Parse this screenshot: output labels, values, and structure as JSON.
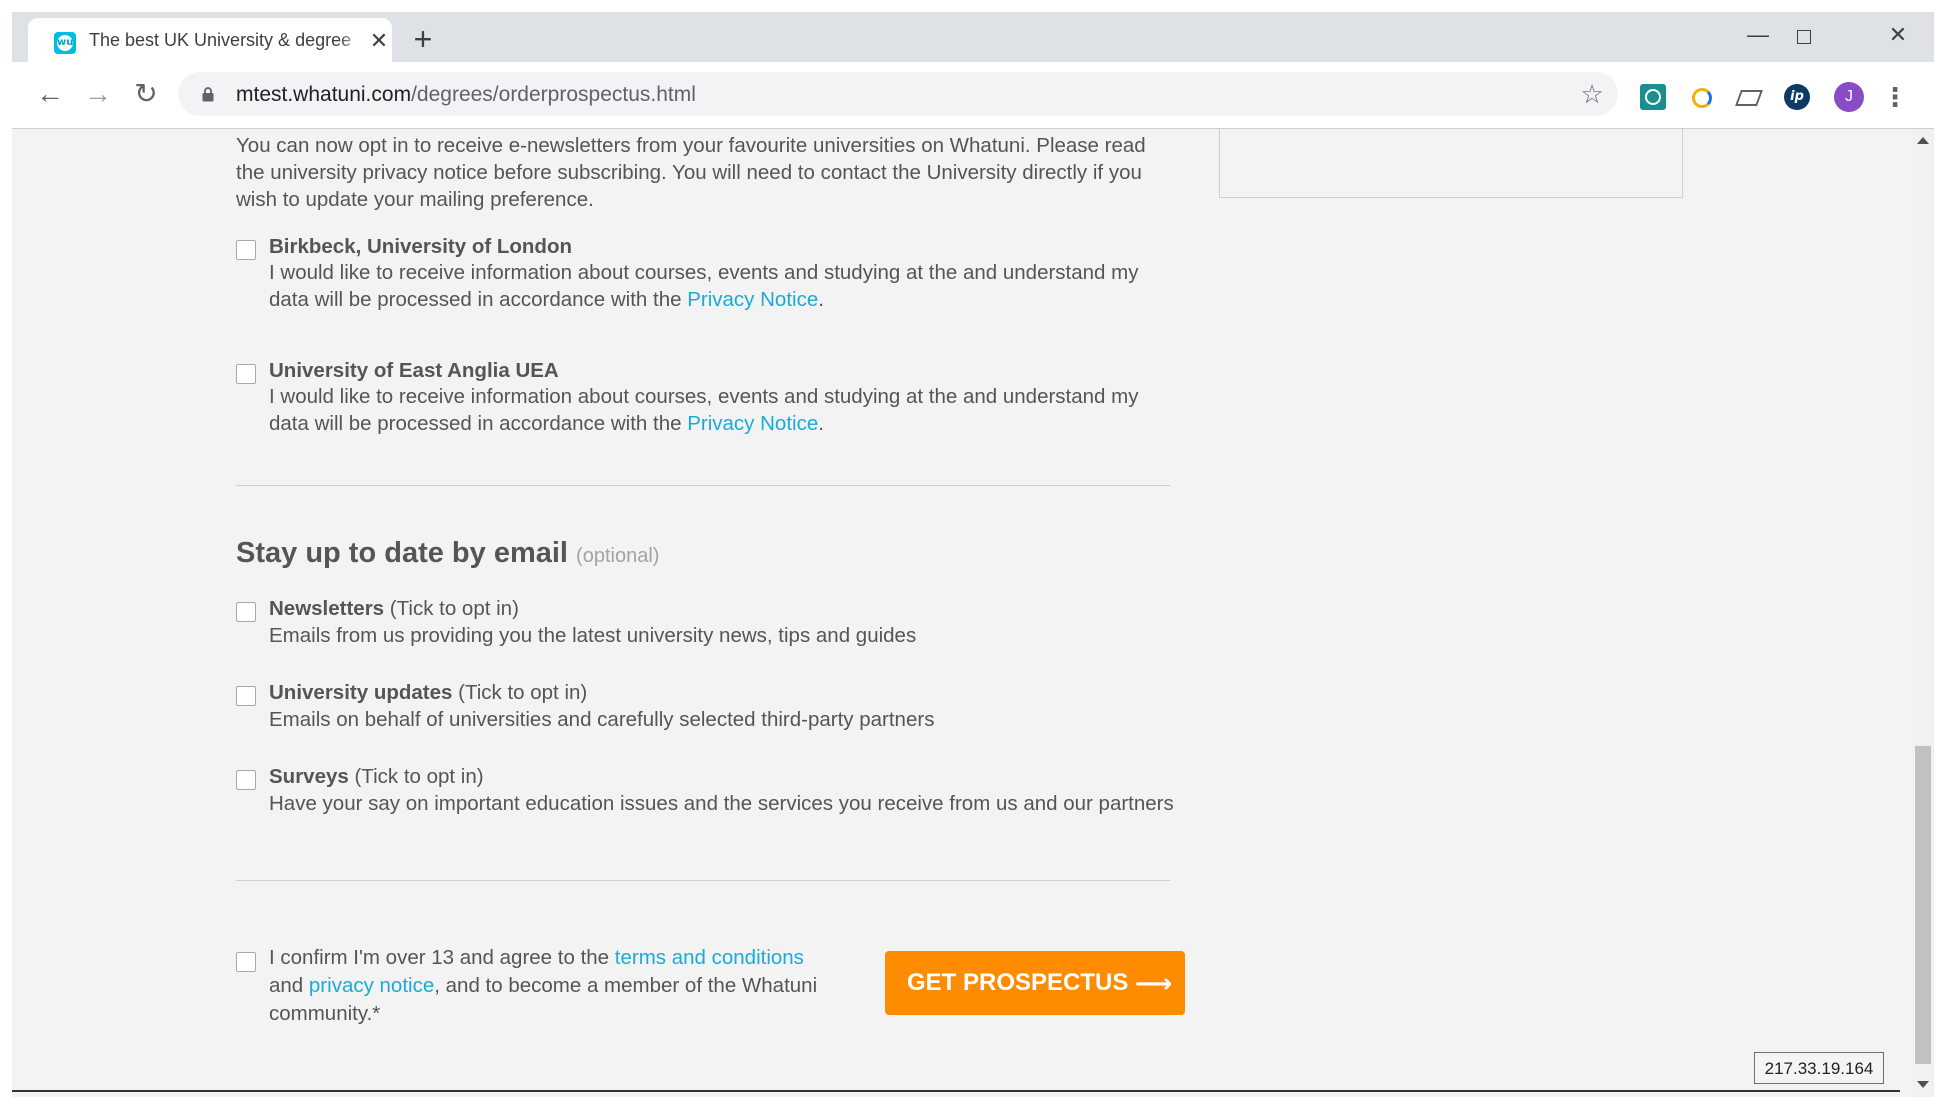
{
  "browser": {
    "tab": {
      "title": "The best UK University & degree",
      "favicon": "whatuni-icon"
    },
    "url": {
      "host": "mtest.whatuni.com",
      "path": "/degrees/orderprospectus.html"
    },
    "avatar_letter": "J",
    "extension_ip_label": "ip"
  },
  "page": {
    "intro": "You can now opt in to receive e-newsletters from your favourite universities on Whatuni. Please read the university privacy notice before subscribing. You will need to contact the University directly if you wish to update your mailing preference.",
    "universities": [
      {
        "name": "Birkbeck, University of London",
        "desc": "I would like to receive information about courses, events and studying at the and understand my data will be processed in accordance with the",
        "link": "Privacy Notice",
        "after": ".",
        "checked": false
      },
      {
        "name": "University of East Anglia UEA",
        "desc": "I would like to receive information about courses, events and studying at the and understand my data will be processed in accordance with the",
        "link": "Privacy Notice",
        "after": ".",
        "checked": false
      }
    ],
    "section": {
      "title": "Stay up to date by email",
      "optional": "(optional)"
    },
    "options": [
      {
        "label": "Newsletters",
        "hint": "(Tick to opt in)",
        "desc": "Emails from us providing you the latest university news, tips and guides",
        "checked": false
      },
      {
        "label": "University updates",
        "hint": "(Tick to opt in)",
        "desc": "Emails on behalf of universities and carefully selected third-party partners",
        "checked": false
      },
      {
        "label": "Surveys",
        "hint": "(Tick to opt in)",
        "desc": "Have your say on important education issues and the services you receive from us and our partners",
        "checked": false
      }
    ],
    "confirm": {
      "part1": "I confirm I'm over 13 and agree to the ",
      "link1": "terms and conditions",
      "part2": "and ",
      "link2": "privacy notice",
      "part3": ", and to become a member of the Whatuni community.*",
      "checked": false
    },
    "cta": {
      "label": "GET PROSPECTUS",
      "arrow": "⟶"
    }
  },
  "ip_address": "217.33.19.164",
  "colors": {
    "accent": "#ff8b00",
    "link": "#1aabd6",
    "text": "#555555"
  }
}
